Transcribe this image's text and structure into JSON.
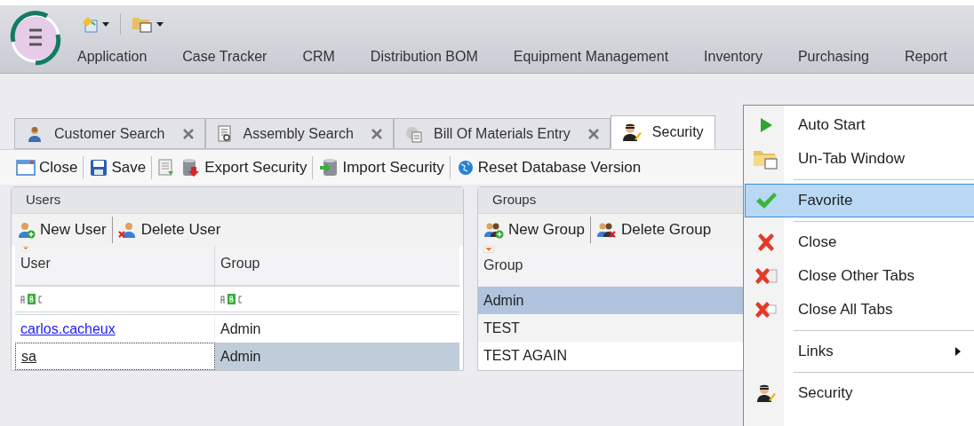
{
  "ribbon": {
    "nav": [
      "Application",
      "Case Tracker",
      "CRM",
      "Distribution BOM",
      "Equipment Management",
      "Inventory",
      "Purchasing",
      "Report"
    ]
  },
  "tabs": [
    {
      "label": "Customer Search",
      "selected": false,
      "closable": true
    },
    {
      "label": "Assembly Search",
      "selected": false,
      "closable": true
    },
    {
      "label": "Bill Of Materials Entry",
      "selected": false,
      "closable": true
    },
    {
      "label": "Security",
      "selected": true,
      "closable": false
    }
  ],
  "toolbar": [
    {
      "kind": "button",
      "label": "Close",
      "divider_before": false
    },
    {
      "kind": "button",
      "label": "Save",
      "divider_before": true
    },
    {
      "kind": "icon",
      "divider_before": true
    },
    {
      "kind": "button",
      "label": "Export Security",
      "divider_before": false
    },
    {
      "kind": "button",
      "label": "Import Security",
      "divider_before": true
    },
    {
      "kind": "button",
      "label": "Reset Database Version",
      "divider_before": true
    }
  ],
  "users": {
    "title": "Users",
    "actions": [
      "New User",
      "Delete User"
    ],
    "columns": [
      "User",
      "Group"
    ],
    "rows": [
      {
        "user": "carlos.cacheux",
        "group": "Admin",
        "selected": false,
        "focused": false
      },
      {
        "user": "sa",
        "group": "Admin",
        "selected": true,
        "focused": true
      }
    ]
  },
  "groups": {
    "title": "Groups",
    "actions": [
      "New Group",
      "Delete Group"
    ],
    "columns": [
      "Group"
    ],
    "rows": [
      {
        "group": "Admin",
        "selected": true
      },
      {
        "group": "TEST",
        "selected": false
      },
      {
        "group": "TEST AGAIN",
        "selected": false
      }
    ]
  },
  "context_menu": [
    {
      "kind": "item",
      "label": "Auto Start",
      "selected": false
    },
    {
      "kind": "item",
      "label": "Un-Tab Window",
      "selected": false
    },
    {
      "kind": "separator"
    },
    {
      "kind": "item",
      "label": "Favorite",
      "selected": true
    },
    {
      "kind": "separator"
    },
    {
      "kind": "item",
      "label": "Close",
      "selected": false
    },
    {
      "kind": "item",
      "label": "Close Other Tabs",
      "selected": false
    },
    {
      "kind": "item",
      "label": "Close All Tabs",
      "selected": false
    },
    {
      "kind": "separator"
    },
    {
      "kind": "item",
      "label": "Links",
      "selected": false,
      "submenu": true
    },
    {
      "kind": "separator"
    },
    {
      "kind": "item",
      "label": "Security",
      "selected": false
    }
  ]
}
